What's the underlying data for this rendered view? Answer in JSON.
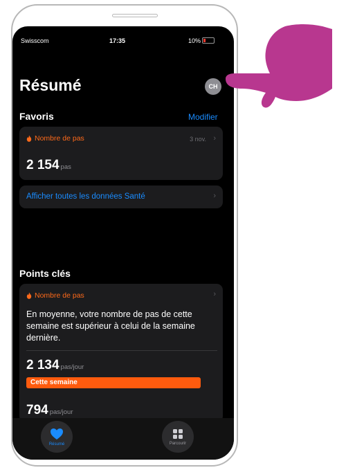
{
  "status": {
    "carrier": "Swisscom",
    "time": "17:35",
    "battery": "10%"
  },
  "header": {
    "title": "Résumé",
    "avatar": "CH"
  },
  "favorites": {
    "title": "Favoris",
    "edit_label": "Modifier",
    "metric_label": "Nombre de pas",
    "date": "3 nov.",
    "value": "2 154",
    "unit": "pas",
    "show_all_label": "Afficher toutes les données Santé"
  },
  "highlights": {
    "title": "Points clés",
    "metric_label": "Nombre de pas",
    "description": "En moyenne, votre nombre de pas de cette semaine est supérieur à celui de la semaine dernière.",
    "this_week_value": "2 134",
    "this_week_unit": "pas/jour",
    "this_week_label": "Cette semaine",
    "last_week_value": "794",
    "last_week_unit": "pas/jour"
  },
  "tabbar": {
    "summary_label": "Résumé",
    "browse_label": "Parcourir"
  },
  "colors": {
    "accent": "#1a8cff",
    "activity": "#ff5b0e",
    "hand": "#b8378f"
  },
  "icons": {
    "flame": "flame-icon",
    "heart": "heart-icon",
    "grid": "grid-icon",
    "hand": "pointing-hand-icon"
  }
}
